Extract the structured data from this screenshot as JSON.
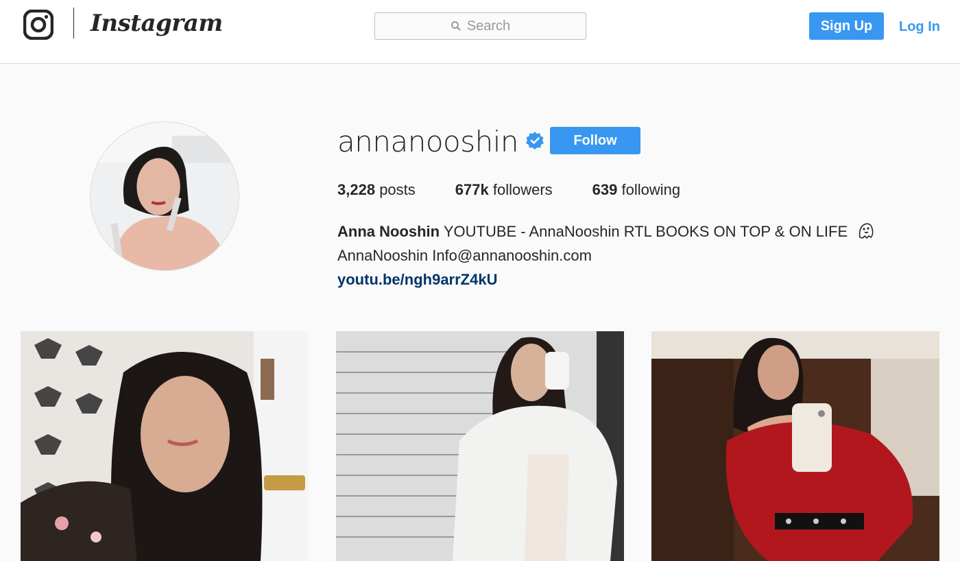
{
  "nav": {
    "wordmark": "Instagram",
    "search_placeholder": "Search",
    "signup_label": "Sign Up",
    "login_label": "Log In"
  },
  "profile": {
    "username": "annanooshin",
    "verified": true,
    "follow_label": "Follow",
    "stats": {
      "posts_count": "3,228",
      "posts_label": "posts",
      "followers_count": "677k",
      "followers_label": "followers",
      "following_count": "639",
      "following_label": "following"
    },
    "bio": {
      "full_name": "Anna Nooshin",
      "line1": "YOUTUBE - AnnaNooshin RTL BOOKS ON TOP & ON LIFE",
      "line1_emoji": "ghost-emoji",
      "line2": "AnnaNooshin Info@annanooshin.com",
      "link": "youtu.be/ngh9arrZ4kU"
    }
  },
  "posts": [
    {
      "index": 1,
      "description": "photo-post"
    },
    {
      "index": 2,
      "description": "photo-post"
    },
    {
      "index": 3,
      "description": "photo-post"
    }
  ],
  "colors": {
    "accent": "#3897f0",
    "link": "#003569",
    "background": "#fafafa",
    "text": "#262626"
  }
}
